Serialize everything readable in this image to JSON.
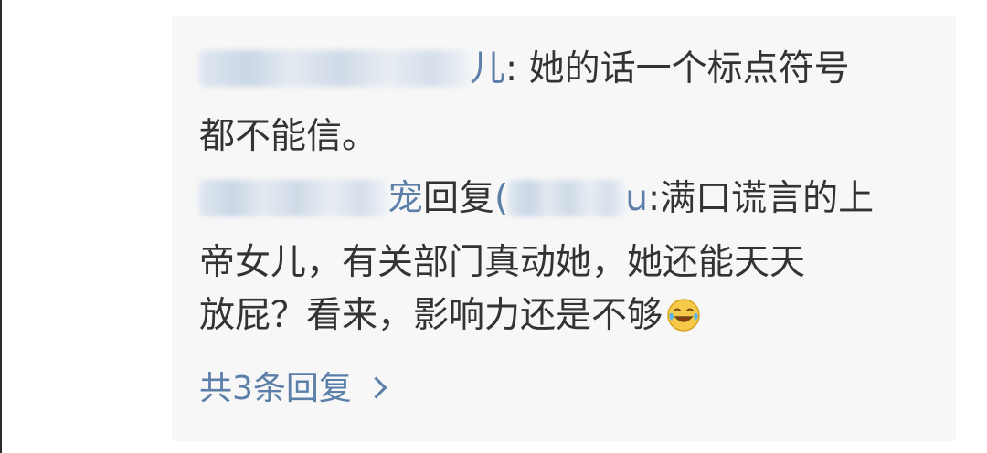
{
  "comment": {
    "author_suffix": "儿",
    "separator": ": ",
    "text_line1": "她的话一个标点符号",
    "text_line2": "都不能信。"
  },
  "reply": {
    "author_suffix": "宠",
    "reply_word": "回复",
    "target_prefix": "(",
    "target_suffix": "u",
    "separator": ":",
    "text_line1_tail": "满口谎言的上",
    "text_line2": "帝女儿，有关部门真动她，她还能天天",
    "text_line3": "放屁？看来，影响力还是不够",
    "emoji": "laughing-crying-emoji"
  },
  "more_replies": {
    "label": "共3条回复"
  },
  "colors": {
    "text": "#333333",
    "link": "#5b7fa8",
    "box_background": "#f7f7f7"
  }
}
